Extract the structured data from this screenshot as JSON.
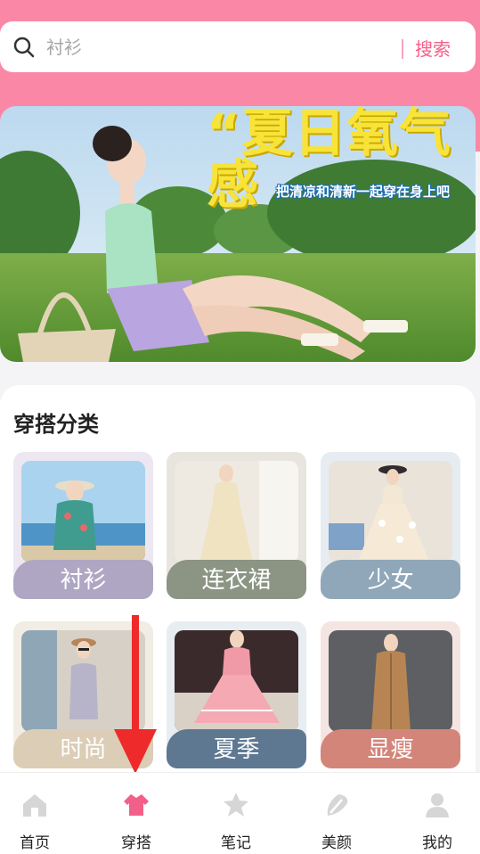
{
  "search": {
    "placeholder": "衬衫",
    "button_label": "搜索"
  },
  "banner": {
    "title": "“夏日氧气感",
    "subtitle": "把清凉和清新一起穿在身上吧"
  },
  "categories": {
    "title": "穿搭分类",
    "items": [
      {
        "label": "衬衫",
        "color": "#aea6c2"
      },
      {
        "label": "连衣裙",
        "color": "#8c9484"
      },
      {
        "label": "少女",
        "color": "#8fa7b8"
      },
      {
        "label": "时尚",
        "color": "#dccdb6"
      },
      {
        "label": "夏季",
        "color": "#5f7892"
      },
      {
        "label": "显瘦",
        "color": "#d3857a"
      }
    ]
  },
  "nav": {
    "items": [
      {
        "label": "首页",
        "icon": "home-icon"
      },
      {
        "label": "穿搭",
        "icon": "outfit-icon"
      },
      {
        "label": "笔记",
        "icon": "notes-icon"
      },
      {
        "label": "美颜",
        "icon": "beauty-icon"
      },
      {
        "label": "我的",
        "icon": "profile-icon"
      }
    ],
    "active_index": 1,
    "active_color": "#f2608a",
    "inactive_color": "#d6d6d6"
  },
  "theme": {
    "accent": "#fb87a6"
  }
}
